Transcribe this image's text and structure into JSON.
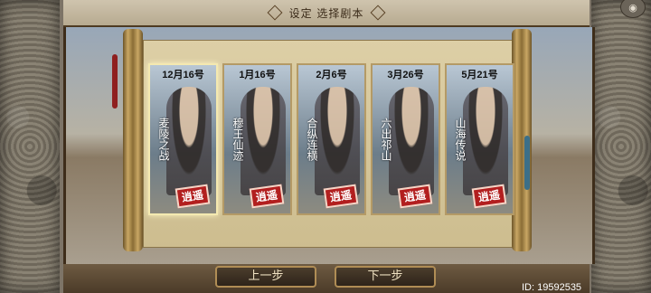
{
  "header": {
    "title": "设定 选择剧本"
  },
  "cards": [
    {
      "date": "12月16号",
      "name": "麦陵之战",
      "badge": "逍遥",
      "selected": true
    },
    {
      "date": "1月16号",
      "name": "穆王仙迹",
      "badge": "逍遥",
      "selected": false
    },
    {
      "date": "2月6号",
      "name": "合纵连横",
      "badge": "逍遥",
      "selected": false
    },
    {
      "date": "3月26号",
      "name": "六出祁山",
      "badge": "逍遥",
      "selected": false
    },
    {
      "date": "5月21号",
      "name": "山海传说",
      "badge": "逍遥",
      "selected": false
    }
  ],
  "buttons": {
    "prev": "上一步",
    "next": "下一步"
  },
  "footer": {
    "id": "ID: 19592535"
  },
  "icons": {
    "camera": "camera-icon"
  }
}
